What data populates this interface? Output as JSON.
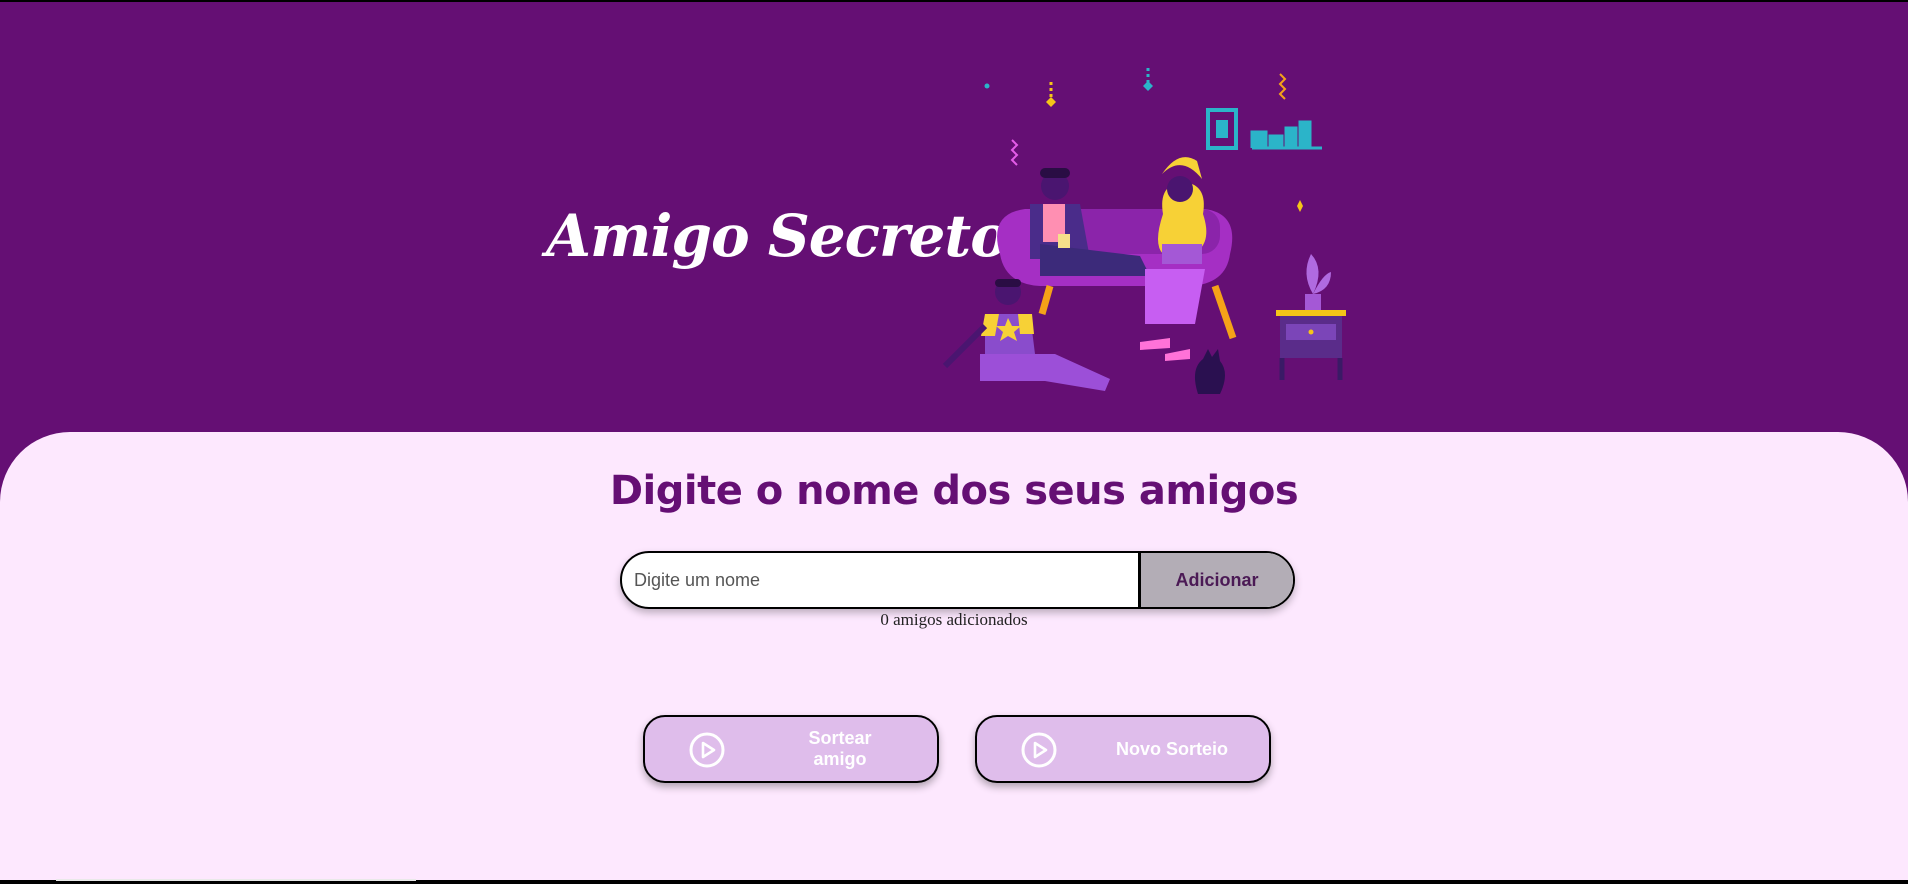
{
  "header": {
    "title": "Amigo Secreto",
    "illustration_icon": "friends-party-illustration"
  },
  "main": {
    "section_title": "Digite o nome dos seus amigos",
    "name_input": {
      "placeholder": "Digite um nome",
      "value": ""
    },
    "add_button_label": "Adicionar",
    "friends_count_text": "0 amigos adicionados",
    "draw_button": {
      "label": "Sortear amigo",
      "icon": "play-circle-icon"
    },
    "new_draw_button": {
      "label": "Novo Sorteio",
      "icon": "play-circle-icon"
    }
  },
  "colors": {
    "header_bg": "#650f74",
    "panel_bg": "#fde8fe",
    "title_color": "#650f74",
    "button_bg": "#dfbdeb",
    "add_button_bg": "#b3adb6"
  }
}
